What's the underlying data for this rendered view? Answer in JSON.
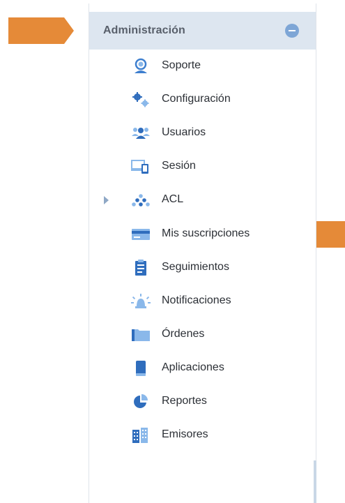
{
  "colors": {
    "accent_orange": "#e58a38",
    "header_bg": "#dde6f0",
    "icon_blue": "#3e7fcf",
    "icon_light_blue": "#8ab8ea"
  },
  "panel": {
    "title": "Administración",
    "collapse_icon": "minus-circle-icon"
  },
  "menu": [
    {
      "label": "Soporte",
      "icon": "headset-icon"
    },
    {
      "label": "Configuración",
      "icon": "gears-icon"
    },
    {
      "label": "Usuarios",
      "icon": "users-icon"
    },
    {
      "label": "Sesión",
      "icon": "devices-icon"
    },
    {
      "label": "ACL",
      "icon": "network-icon",
      "expandable": true
    },
    {
      "label": "Mis suscripciones",
      "icon": "credit-card-icon"
    },
    {
      "label": "Seguimientos",
      "icon": "clipboard-icon"
    },
    {
      "label": "Notificaciones",
      "icon": "alarm-icon"
    },
    {
      "label": "Órdenes",
      "icon": "folder-icon"
    },
    {
      "label": "Aplicaciones",
      "icon": "mobile-icon"
    },
    {
      "label": "Reportes",
      "icon": "pie-chart-icon"
    },
    {
      "label": "Emisores",
      "icon": "buildings-icon"
    }
  ],
  "callouts": [
    {
      "icon": "arrow-right-icon",
      "target": "Administración"
    },
    {
      "icon": "arrow-left-icon",
      "target": "Mis suscripciones"
    }
  ]
}
